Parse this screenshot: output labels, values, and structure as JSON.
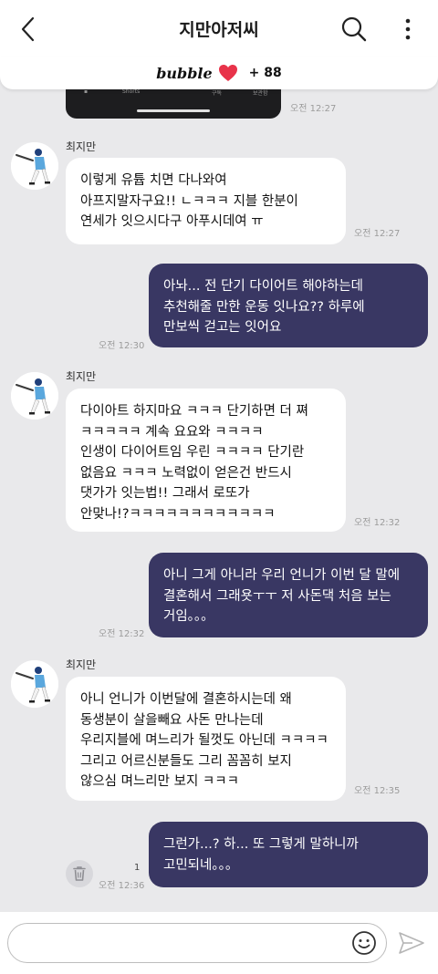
{
  "header": {
    "title": "지만아저씨",
    "back_icon": "chevron-left-icon",
    "search_icon": "search-icon",
    "more_icon": "more-vertical-icon"
  },
  "bubble_bar": {
    "logo": "bubble",
    "heart_color": "#e8334a",
    "count": "+ 88"
  },
  "shared_image": {
    "tabs": [
      "Shorts",
      "구독",
      "보관함"
    ],
    "time": "오전 12:27"
  },
  "messages": [
    {
      "sender": "최지만",
      "lines": [
        "이렇게 유튭 치면 다나와여",
        "아프지말자구요!! ㄴㅋㅋㅋ 지블 한분이",
        "연세가 잇으시다구 아푸시데여 ㅠ"
      ],
      "time": "오전 12:27"
    },
    {
      "lines": [
        "아놔... 전 단기 다이어트 해야하는데",
        "추천해줄 만한 운동 잇나요?? 하루에",
        "만보씩 걷고는 잇어요"
      ],
      "time": "오전 12:30"
    },
    {
      "sender": "최지만",
      "lines": [
        "다이아트 하지마요 ㅋㅋㅋ 단기하면 더 쪄",
        "ㅋㅋㅋㅋㅋ 계속 요요와 ㅋㅋㅋㅋ",
        "인생이 다이어트임 우린 ㅋㅋㅋㅋ 단기란",
        "없음요 ㅋㅋㅋ 노력없이 얻은건 반드시",
        "댓가가 잇는법!! 그래서 로또가",
        "안맞나!?ㅋㅋㅋㅋㅋㅋㅋㅋㅋㅋㅋㅋ"
      ],
      "time": "오전 12:32"
    },
    {
      "lines": [
        "아니 그게 아니라 우리 언니가 이번 달 말에",
        "결혼해서 그래욧ㅜㅜ 저 사돈댁 처음 보는",
        "거임。。。"
      ],
      "time": "오전 12:32"
    },
    {
      "sender": "최지만",
      "lines": [
        "아니 언니가 이번달에 결혼하시는데 왜",
        "동생분이 살을빼요 사돈 만나는데",
        "우리지블에 며느리가 될껏도 아닌데 ㅋㅋㅋㅋ",
        "그리고 어르신분들도 그리 꼼꼼히 보지",
        "않으심 며느리만 보지 ㅋㅋㅋ"
      ],
      "time": "오전 12:35"
    },
    {
      "lines": [
        "그런가...? 하... 또 그렇게 말하니까",
        "고민되네。。。"
      ],
      "time": "오전 12:36",
      "unread": "1"
    }
  ],
  "input": {
    "placeholder": "",
    "emoji_icon": "smiley-icon",
    "send_icon": "send-icon",
    "trash_icon": "trash-icon"
  },
  "colors": {
    "background": "#e9e9eb",
    "outgoing_bubble": "#393763",
    "incoming_bubble": "#ffffff",
    "heart": "#e8334a"
  }
}
